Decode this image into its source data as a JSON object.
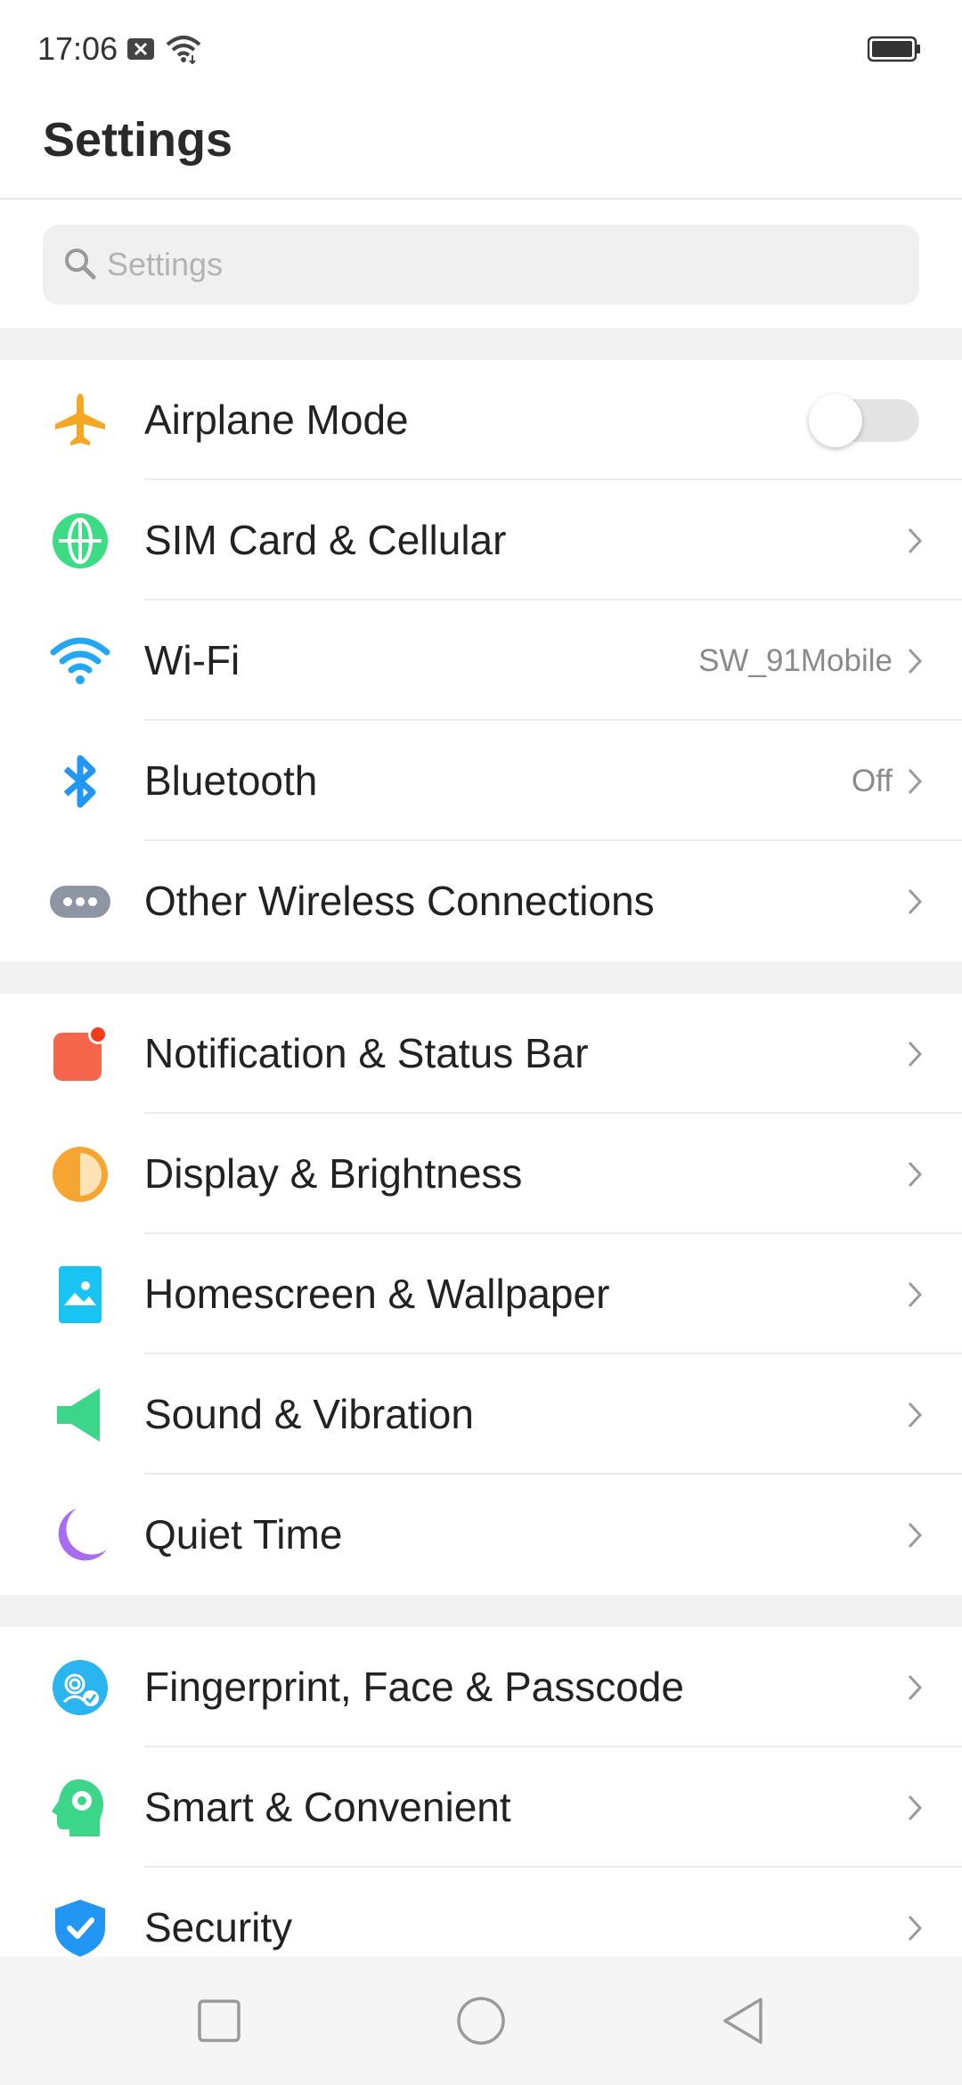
{
  "status_bar": {
    "time": "17:06"
  },
  "header": {
    "title": "Settings"
  },
  "search": {
    "placeholder": "Settings"
  },
  "colors": {
    "airplane": "#f5a623",
    "sim": "#3ddc84",
    "wifi": "#23a7f2",
    "bluetooth": "#2196f3",
    "other_wireless": "#8e95a3",
    "notification": "#f5664b",
    "display": "#f7a531",
    "homescreen": "#19c3f2",
    "sound": "#3cd68a",
    "quiet": "#a86cf0",
    "fingerprint": "#2bb5f0",
    "smart": "#3cd68a",
    "security": "#2196f3"
  },
  "sections": [
    {
      "items": [
        {
          "label": "Airplane Mode",
          "icon": "airplane-icon",
          "control": "toggle",
          "toggle_on": false
        },
        {
          "label": "SIM Card & Cellular",
          "icon": "globe-icon"
        },
        {
          "label": "Wi-Fi",
          "icon": "wifi-icon",
          "value": "SW_91Mobile"
        },
        {
          "label": "Bluetooth",
          "icon": "bluetooth-icon",
          "value": "Off"
        },
        {
          "label": "Other Wireless Connections",
          "icon": "more-dots-icon"
        }
      ]
    },
    {
      "items": [
        {
          "label": "Notification & Status Bar",
          "icon": "notification-icon"
        },
        {
          "label": "Display & Brightness",
          "icon": "brightness-icon"
        },
        {
          "label": "Homescreen & Wallpaper",
          "icon": "wallpaper-icon"
        },
        {
          "label": "Sound & Vibration",
          "icon": "speaker-icon"
        },
        {
          "label": "Quiet Time",
          "icon": "moon-icon"
        }
      ]
    },
    {
      "items": [
        {
          "label": "Fingerprint, Face & Passcode",
          "icon": "fingerprint-icon"
        },
        {
          "label": "Smart & Convenient",
          "icon": "smart-head-icon"
        },
        {
          "label": "Security",
          "icon": "shield-icon"
        }
      ]
    }
  ],
  "nav_bar": {
    "buttons": [
      "recents-icon",
      "home-icon",
      "back-icon"
    ]
  }
}
